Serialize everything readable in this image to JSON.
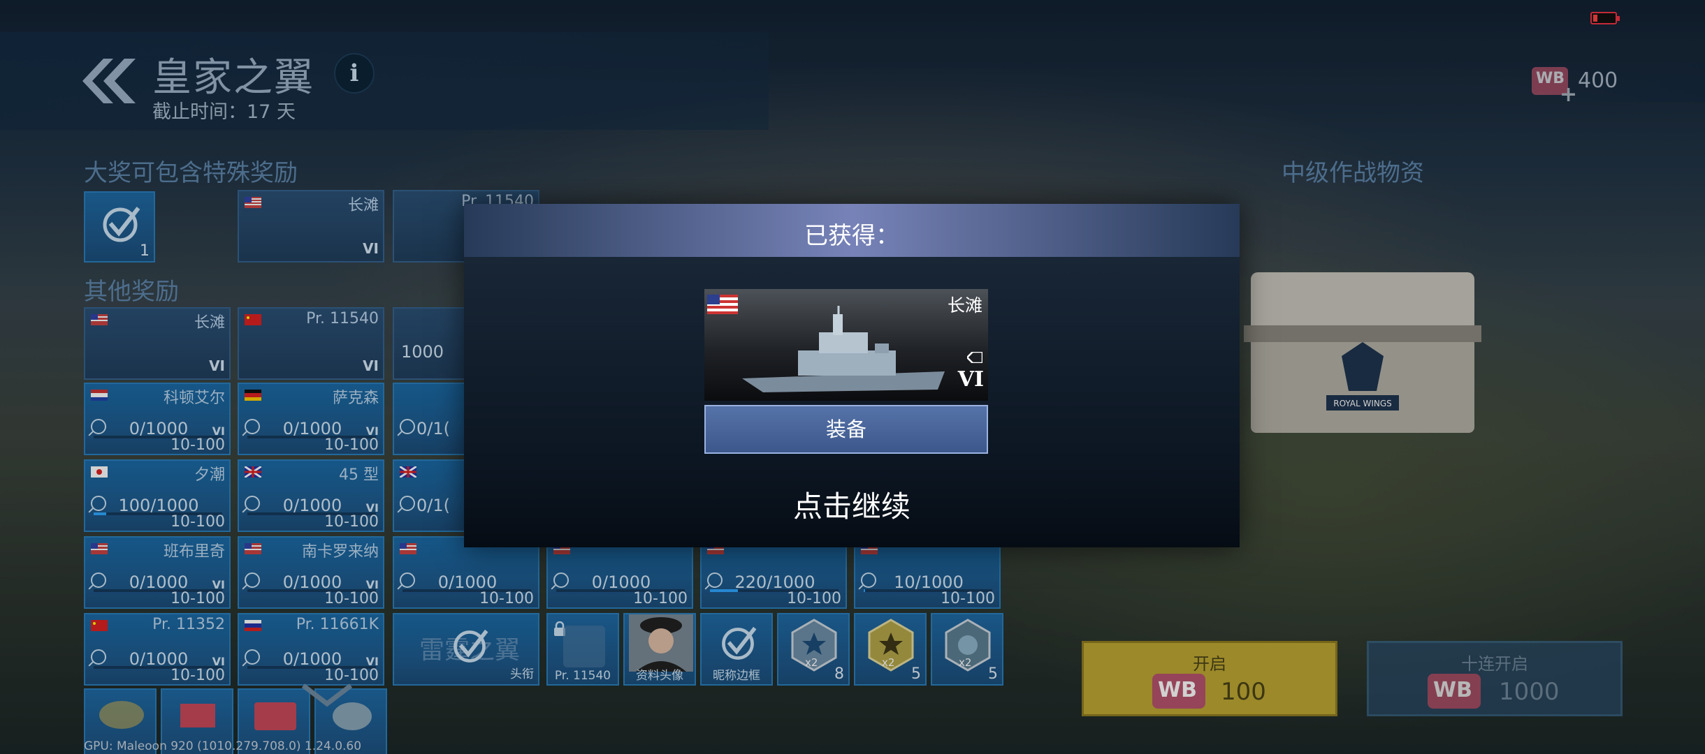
{
  "header": {
    "title": "皇家之翼",
    "deadline": "截止时间：17 天",
    "info_icon": "i"
  },
  "currency": {
    "icon_label": "WB",
    "plus": "+",
    "amount": "400"
  },
  "sections": {
    "grand_prize": "大奖可包含特殊奖励",
    "other_rewards": "其他奖励",
    "supplies": "中级作战物资"
  },
  "grand_prize": {
    "insignia_count": "1",
    "ships": [
      {
        "name": "长滩",
        "tier": "VI"
      },
      {
        "name": "Pr. 11540",
        "tier": ""
      }
    ]
  },
  "other_rewards": {
    "row1": [
      {
        "name": "长滩",
        "tier": "VI"
      },
      {
        "name": "Pr. 11540",
        "tier": "VI"
      },
      {
        "name": "",
        "progress": "1000"
      }
    ],
    "row2": [
      {
        "name": "科顿艾尔",
        "progress": "0/1000",
        "level": "10-100",
        "tier": "VI"
      },
      {
        "name": "萨克森",
        "progress": "0/1000",
        "level": "10-100",
        "tier": "VI"
      },
      {
        "name": "",
        "progress": "0/1(",
        "level": ""
      }
    ],
    "row3": [
      {
        "name": "夕潮",
        "progress": "100/1000",
        "level": "10-100",
        "tier": "",
        "fill": 0.1
      },
      {
        "name": "45 型",
        "progress": "0/1000",
        "level": "10-100",
        "tier": "VI"
      },
      {
        "name": "",
        "progress": "0/1(",
        "level": ""
      }
    ],
    "row4": [
      {
        "name": "班布里奇",
        "progress": "0/1000",
        "level": "10-100",
        "tier": "VI",
        "fill": 0
      },
      {
        "name": "南卡罗来纳",
        "progress": "0/1000",
        "level": "10-100",
        "tier": "VI",
        "fill": 0
      },
      {
        "name": "",
        "progress": "0/1000",
        "level": "10-100",
        "tier": "",
        "fill": 0
      },
      {
        "name": "",
        "progress": "0/1000",
        "level": "10-100",
        "tier": "",
        "fill": 0
      },
      {
        "name": "",
        "progress": "220/1000",
        "level": "10-100",
        "tier": "",
        "fill": 0.22
      },
      {
        "name": "",
        "progress": "10/1000",
        "level": "10-100",
        "tier": "",
        "fill": 0.01
      }
    ],
    "row5": [
      {
        "name": "Pr. 11352",
        "progress": "0/1000",
        "level": "10-100",
        "tier": "VI"
      },
      {
        "name": "Pr. 11661K",
        "progress": "0/1000",
        "level": "10-100",
        "tier": "VI"
      }
    ],
    "row5_extra": {
      "insignia_text": "雷霆之翼",
      "insignia_caption": "头衔",
      "locked_caption": "Pr. 11540",
      "avatar_caption": "资料头像",
      "frame_caption": "昵称边框",
      "boosts": [
        {
          "mult": "x2",
          "count": "8"
        },
        {
          "mult": "x2",
          "count": "5"
        },
        {
          "mult": "x2",
          "count": "5"
        }
      ]
    }
  },
  "buttons": {
    "open": {
      "label": "开启",
      "icon": "WB",
      "amount": "100"
    },
    "open_ten": {
      "label": "十连开启",
      "icon": "WB",
      "amount": "1000"
    }
  },
  "gpu_info": "GPU: Maleoon 920 (1010.279.708.0)  1.24.0.60",
  "modal": {
    "title": "已获得：",
    "reward_name": "长滩",
    "reward_tier": "VI",
    "equip_label": "装备",
    "continue_label": "点击继续"
  },
  "colors": {
    "accent_blue": "#1e6aa6",
    "open_button": "#bfa832",
    "wb_pink": "#b8546d"
  }
}
